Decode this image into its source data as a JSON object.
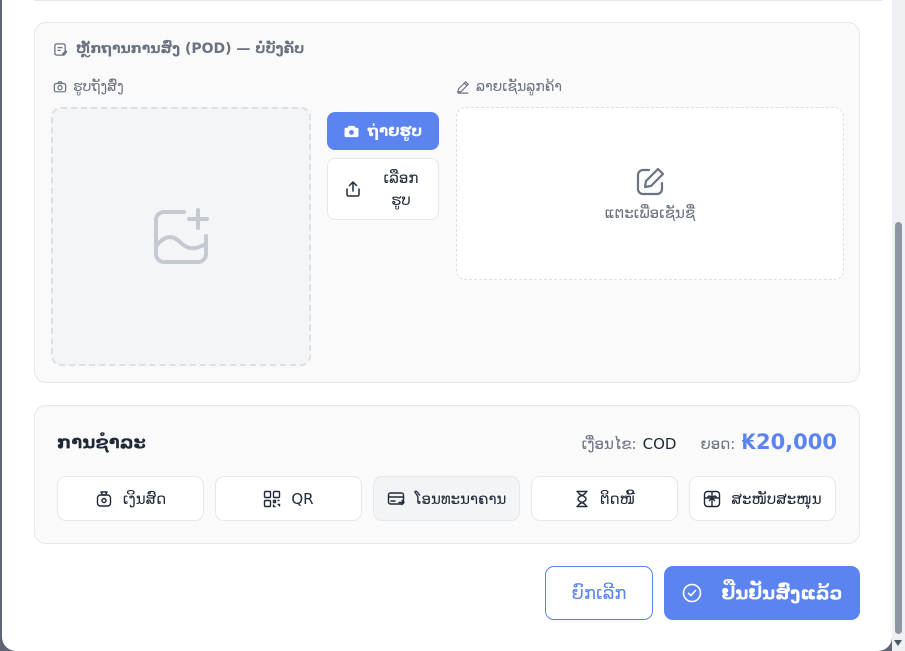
{
  "pod": {
    "title": "ຫຼັກຖານການສົ່ງ (POD) — ບໍ່ບັງຄັບ",
    "photo_label": "ຮູບຖັງສົ່ງ",
    "take_photo_label": "ຖ່າຍຮູບ",
    "choose_photo_label": "ເລືອກ ຮູບ",
    "signature_label": "ລາຍເຊັນລູກຄ້າ",
    "signature_hint": "ແຕະເພື່ອເຊັນຊື່"
  },
  "payment": {
    "title": "ການຊຳລະ",
    "method_prefix": "ເງື່ອນໄຂ:",
    "method_value": "COD",
    "total_prefix": "ຍອດ:",
    "total_value": "₭20,000",
    "methods": [
      {
        "label": "ເງິນສົດ",
        "icon": "cash-bag-icon",
        "selected": false
      },
      {
        "label": "QR",
        "icon": "qr-icon",
        "selected": false
      },
      {
        "label": "ໂອນທະນາຄານ",
        "icon": "card-transfer-icon",
        "selected": true
      },
      {
        "label": "ຕິດໜີ້",
        "icon": "hourglass-icon",
        "selected": false
      },
      {
        "label": "ສະໜັບສະໜຸນ",
        "icon": "gift-icon",
        "selected": false
      }
    ]
  },
  "actions": {
    "cancel_label": "ຍົກເລີກ",
    "confirm_label": "ຢືນຢັນສົ່ງແລ້ວ"
  },
  "colors": {
    "accent": "#5b84f1",
    "muted": "#6b7280"
  }
}
